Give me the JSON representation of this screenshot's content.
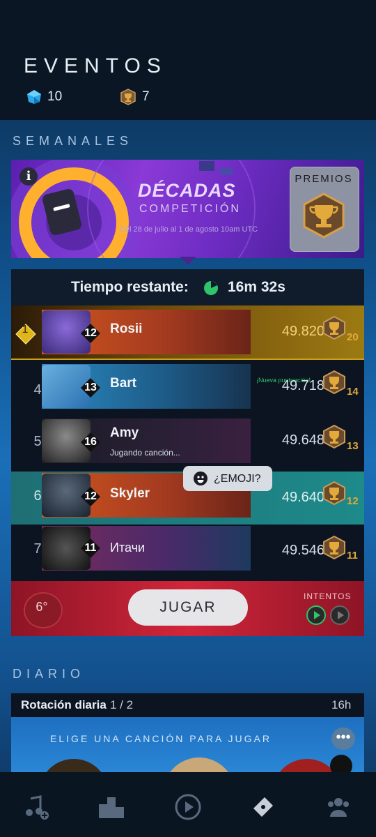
{
  "header": {
    "title": "EVENTOS",
    "gems": "10",
    "trophies": "7"
  },
  "weekly": {
    "section_label": "SEMANALES",
    "banner": {
      "title": "DÉCADAS",
      "subtitle": "COMPETICIÓN",
      "dates": "Del 28 de julio al 1 de agosto 10am UTC",
      "prizes_label": "PREMIOS"
    },
    "timer": {
      "label": "Tiempo restante:",
      "value": "16m 32s"
    },
    "rows": [
      {
        "rank": "1",
        "level": "12",
        "name": "Rosii",
        "score": "49.820",
        "trophies": "20"
      },
      {
        "rank": "4",
        "level": "13",
        "name": "Bart",
        "score": "49.718",
        "trophies": "14",
        "note": "¡Nueva puntuación!"
      },
      {
        "rank": "5",
        "level": "16",
        "name": "Amy",
        "score": "49.648",
        "trophies": "13",
        "status": "Jugando canción..."
      },
      {
        "rank": "6",
        "level": "12",
        "name": "Skyler",
        "score": "49.640",
        "trophies": "12"
      },
      {
        "rank": "7",
        "level": "11",
        "name": "Итачи",
        "score": "49.546",
        "trophies": "11"
      }
    ],
    "emoji_label": "¿EMOJI?",
    "temperature": "6°",
    "play_label": "JUGAR",
    "attempts_label": "INTENTOS"
  },
  "daily": {
    "section_label": "DIARIO",
    "title": "Rotación diaria",
    "progress": "1 / 2",
    "time_left": "16h",
    "prompt": "ELIGE UNA CANCIÓN PARA JUGAR",
    "more_label": "•••"
  },
  "colors": {
    "gold": "#e3a93a",
    "accent_green": "#2fc36a",
    "play_red": "#d2263a"
  },
  "icons": [
    "gem-icon",
    "trophy-icon",
    "info-icon",
    "timer-icon",
    "emoji-icon",
    "play-icon",
    "music-add-icon",
    "podium-icon",
    "play-circle-icon",
    "ticket-icon",
    "friends-icon"
  ]
}
